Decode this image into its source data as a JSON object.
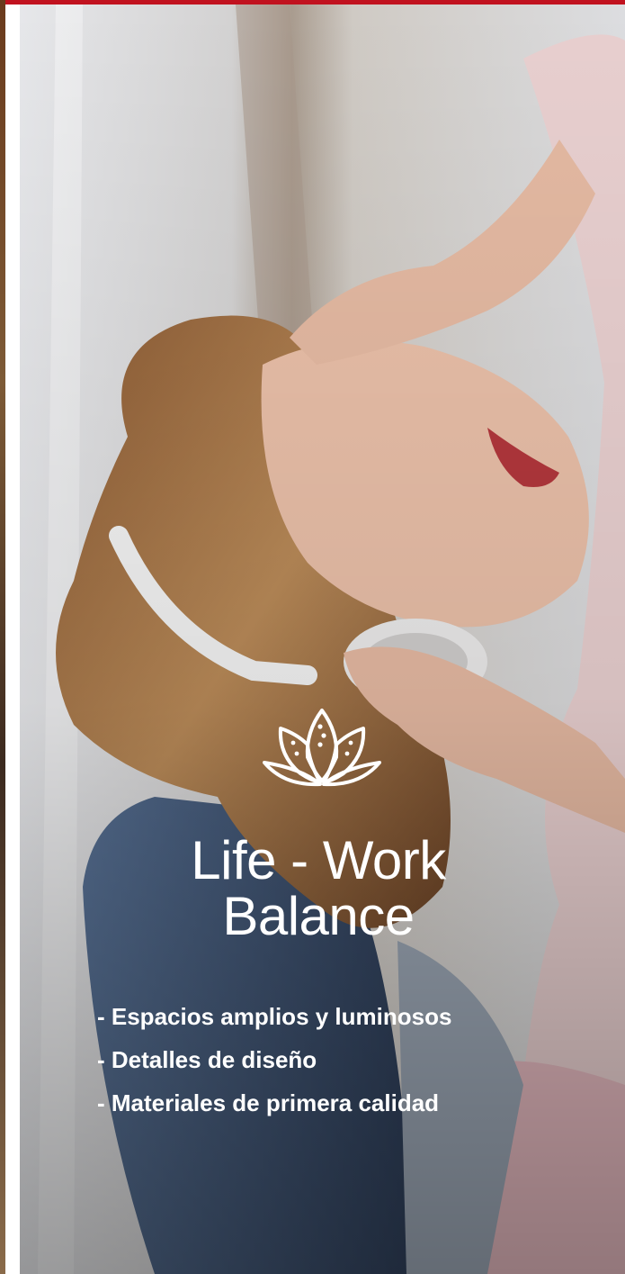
{
  "hero": {
    "title_line1": "Life - Work",
    "title_line2": "Balance",
    "icon": "lotus-icon"
  },
  "features": [
    "- Espacios amplios y luminosos",
    "- Detalles de diseño",
    "- Materiales de primera calidad"
  ],
  "colors": {
    "accent": "#c1121f",
    "text": "#ffffff",
    "sofa": "#3e5476"
  }
}
